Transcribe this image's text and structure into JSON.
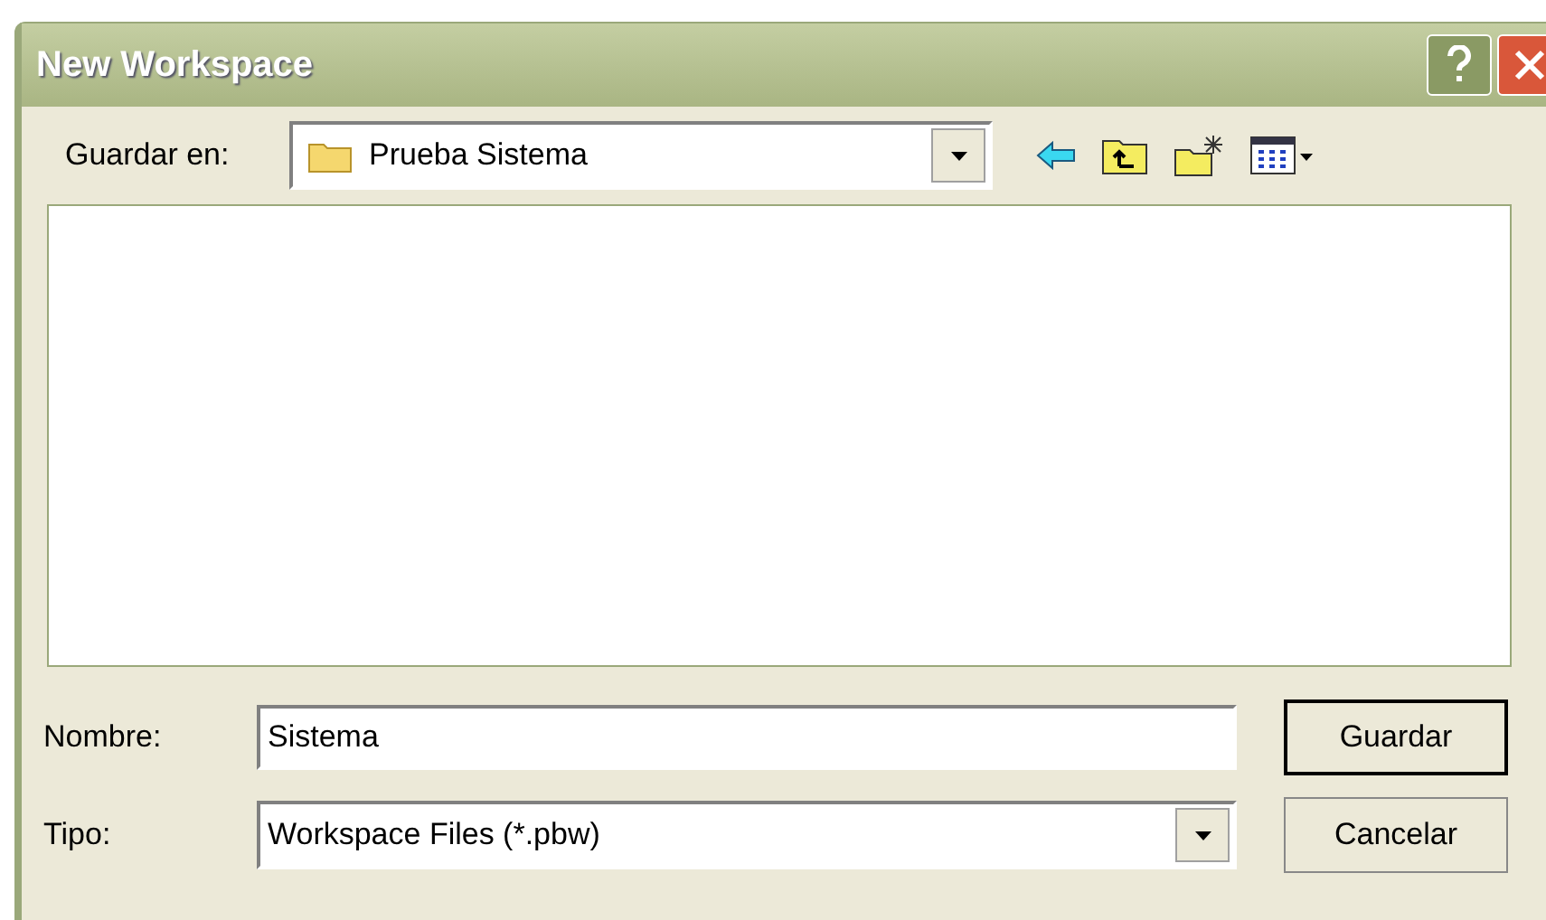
{
  "window": {
    "title": "New Workspace"
  },
  "save_in": {
    "label": "Guardar en:",
    "value": "Prueba Sistema"
  },
  "name_field": {
    "label": "Nombre:",
    "value": "Sistema"
  },
  "type_field": {
    "label": "Tipo:",
    "value": "Workspace Files (*.pbw)"
  },
  "buttons": [
    {
      "label": "Guardar",
      "default": true
    },
    {
      "label": "Cancelar",
      "default": false
    }
  ]
}
